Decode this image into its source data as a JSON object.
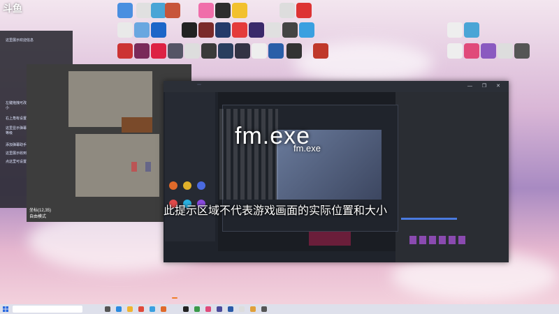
{
  "watermark_logo": "斗鱼",
  "overlay_left": {
    "lines": [
      "这里展示欢迎信息",
      "",
      "",
      "",
      "",
      "左键拖拽可改变位置，右键拉伸可改变大小",
      "右上角有设置菜单",
      "这里显示弹幕，支持开播/下播、粉丝牌等级",
      "",
      "添加弹幕助手成功",
      "这里展示收到的礼物、道具",
      "点这里可设置小礼物屏蔽"
    ],
    "game_hud": [
      "坐标(12,35)",
      "自由模式"
    ]
  },
  "browser": {
    "app_logo": "",
    "badge": "",
    "window_controls": "— ❐ ✕",
    "side_rows": [
      "",
      "",
      "",
      "",
      "",
      "",
      ""
    ],
    "right_texts": [
      "",
      "",
      "",
      "",
      "",
      "",
      ""
    ]
  },
  "overlays": {
    "title": "fm.exe",
    "title_echo": "fm.exe",
    "brand": "",
    "caption": "此提示区域不代表游戏画面的实际位置和大小",
    "stats_line1": "",
    "stats_line2": ""
  },
  "taskbar": {
    "search_placeholder": "",
    "tooltip": "",
    "tray_line1": "",
    "tray_line2": ""
  },
  "colors": {
    "accent_orange": "#f08a1e",
    "stat_red": "#ff5c3a",
    "taskbar": "#dce0eb"
  }
}
